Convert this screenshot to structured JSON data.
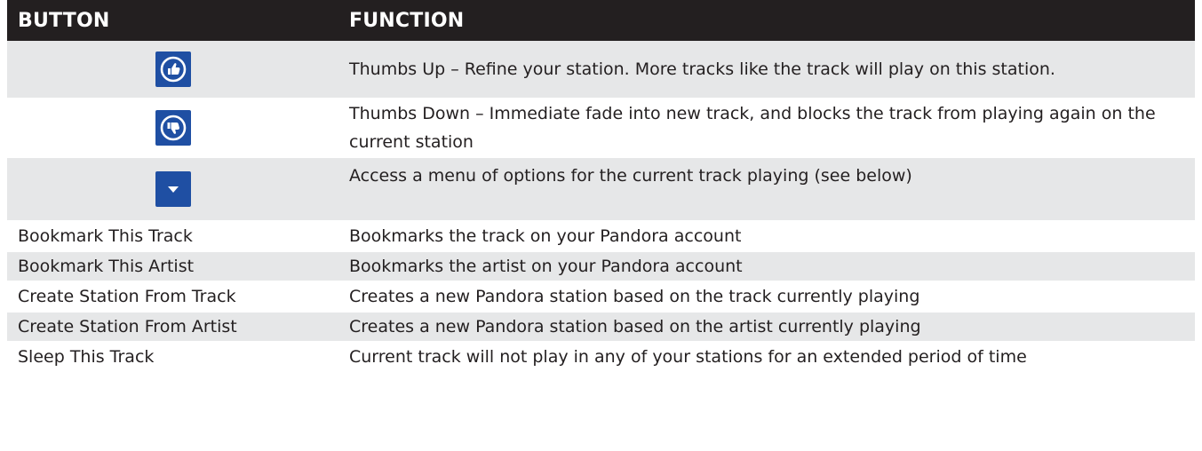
{
  "table": {
    "headers": {
      "button": "BUTTON",
      "function": "FUNCTION"
    },
    "icon_rows": [
      {
        "icon": "thumbs-up-icon",
        "function": "Thumbs Up – Refine your station. More tracks like the track will play on this station."
      },
      {
        "icon": "thumbs-down-icon",
        "function": "Thumbs Down – Immediate fade into new track, and blocks the track from playing again on the current station"
      },
      {
        "icon": "chevron-down-icon",
        "function": "Access a menu of options for the current track playing (see below)"
      }
    ],
    "text_rows": [
      {
        "button": "Bookmark This Track",
        "function": "Bookmarks the track on your Pandora account"
      },
      {
        "button": "Bookmark This Artist",
        "function": "Bookmarks the artist on your Pandora account"
      },
      {
        "button": "Create Station From Track",
        "function": "Creates a new Pandora station based on the track currently playing"
      },
      {
        "button": "Create Station From Artist",
        "function": "Creates a new Pandora station based on the artist currently playing"
      },
      {
        "button": "Sleep This Track",
        "function": "Current track will not play in any of your stations for an extended period of time"
      }
    ]
  },
  "colors": {
    "header_bg": "#231f20",
    "header_text": "#ffffff",
    "shaded_row": "#e6e7e8",
    "icon_button": "#1f4fa3"
  }
}
